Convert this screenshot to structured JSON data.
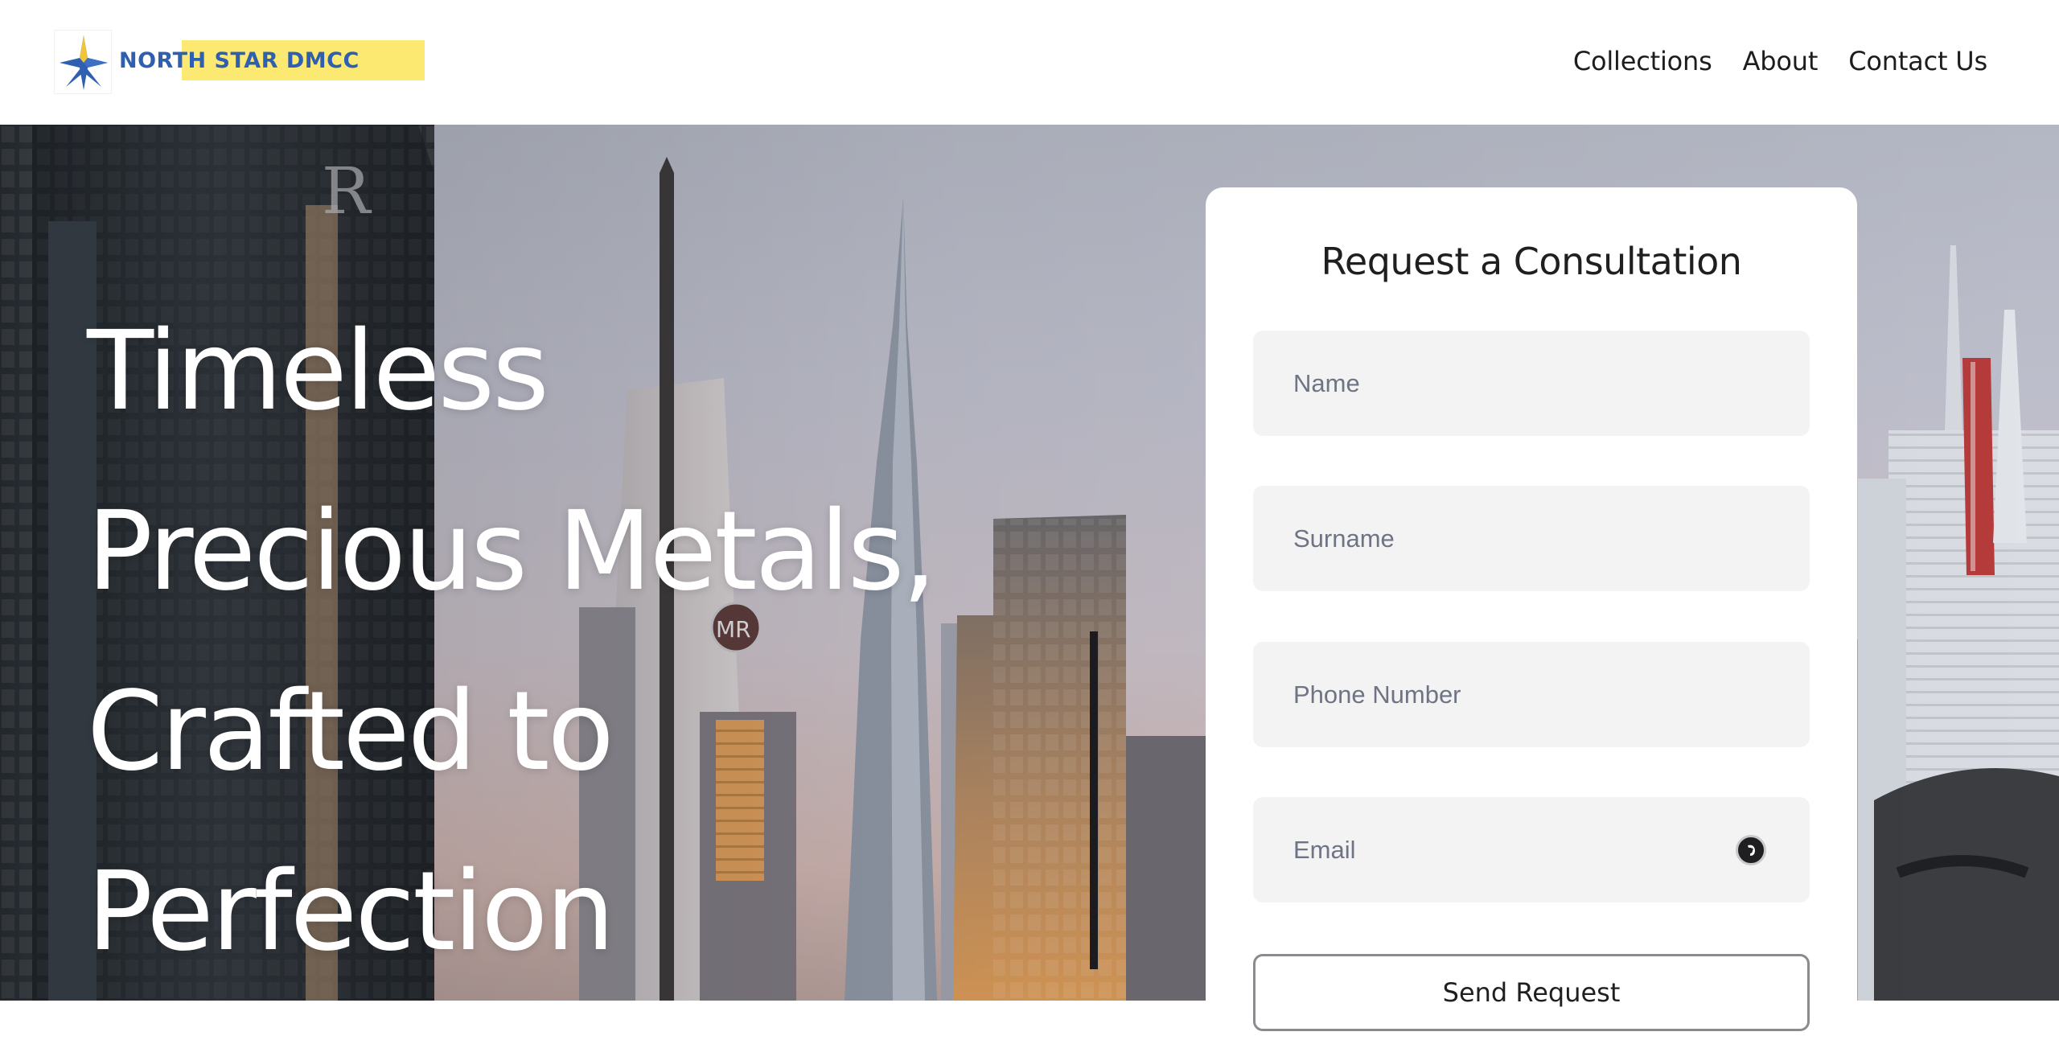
{
  "header": {
    "logo_text": "NORTH STAR DMCC",
    "logo_colors": {
      "text": "#2f5fb0",
      "highlight": "#fbe971"
    },
    "nav": [
      {
        "label": "Collections"
      },
      {
        "label": "About"
      },
      {
        "label": "Contact Us"
      }
    ]
  },
  "hero": {
    "headline_lines": [
      "Timeless",
      "Precious Metals,",
      "Crafted to",
      "Perfection"
    ]
  },
  "form": {
    "title": "Request a Consultation",
    "fields": {
      "name": {
        "placeholder": "Name",
        "value": ""
      },
      "surname": {
        "placeholder": "Surname",
        "value": ""
      },
      "phone": {
        "placeholder": "Phone Number",
        "value": ""
      },
      "email": {
        "placeholder": "Email",
        "value": ""
      }
    },
    "submit_label": "Send Request",
    "email_helper_icon": "autofill-icon"
  }
}
